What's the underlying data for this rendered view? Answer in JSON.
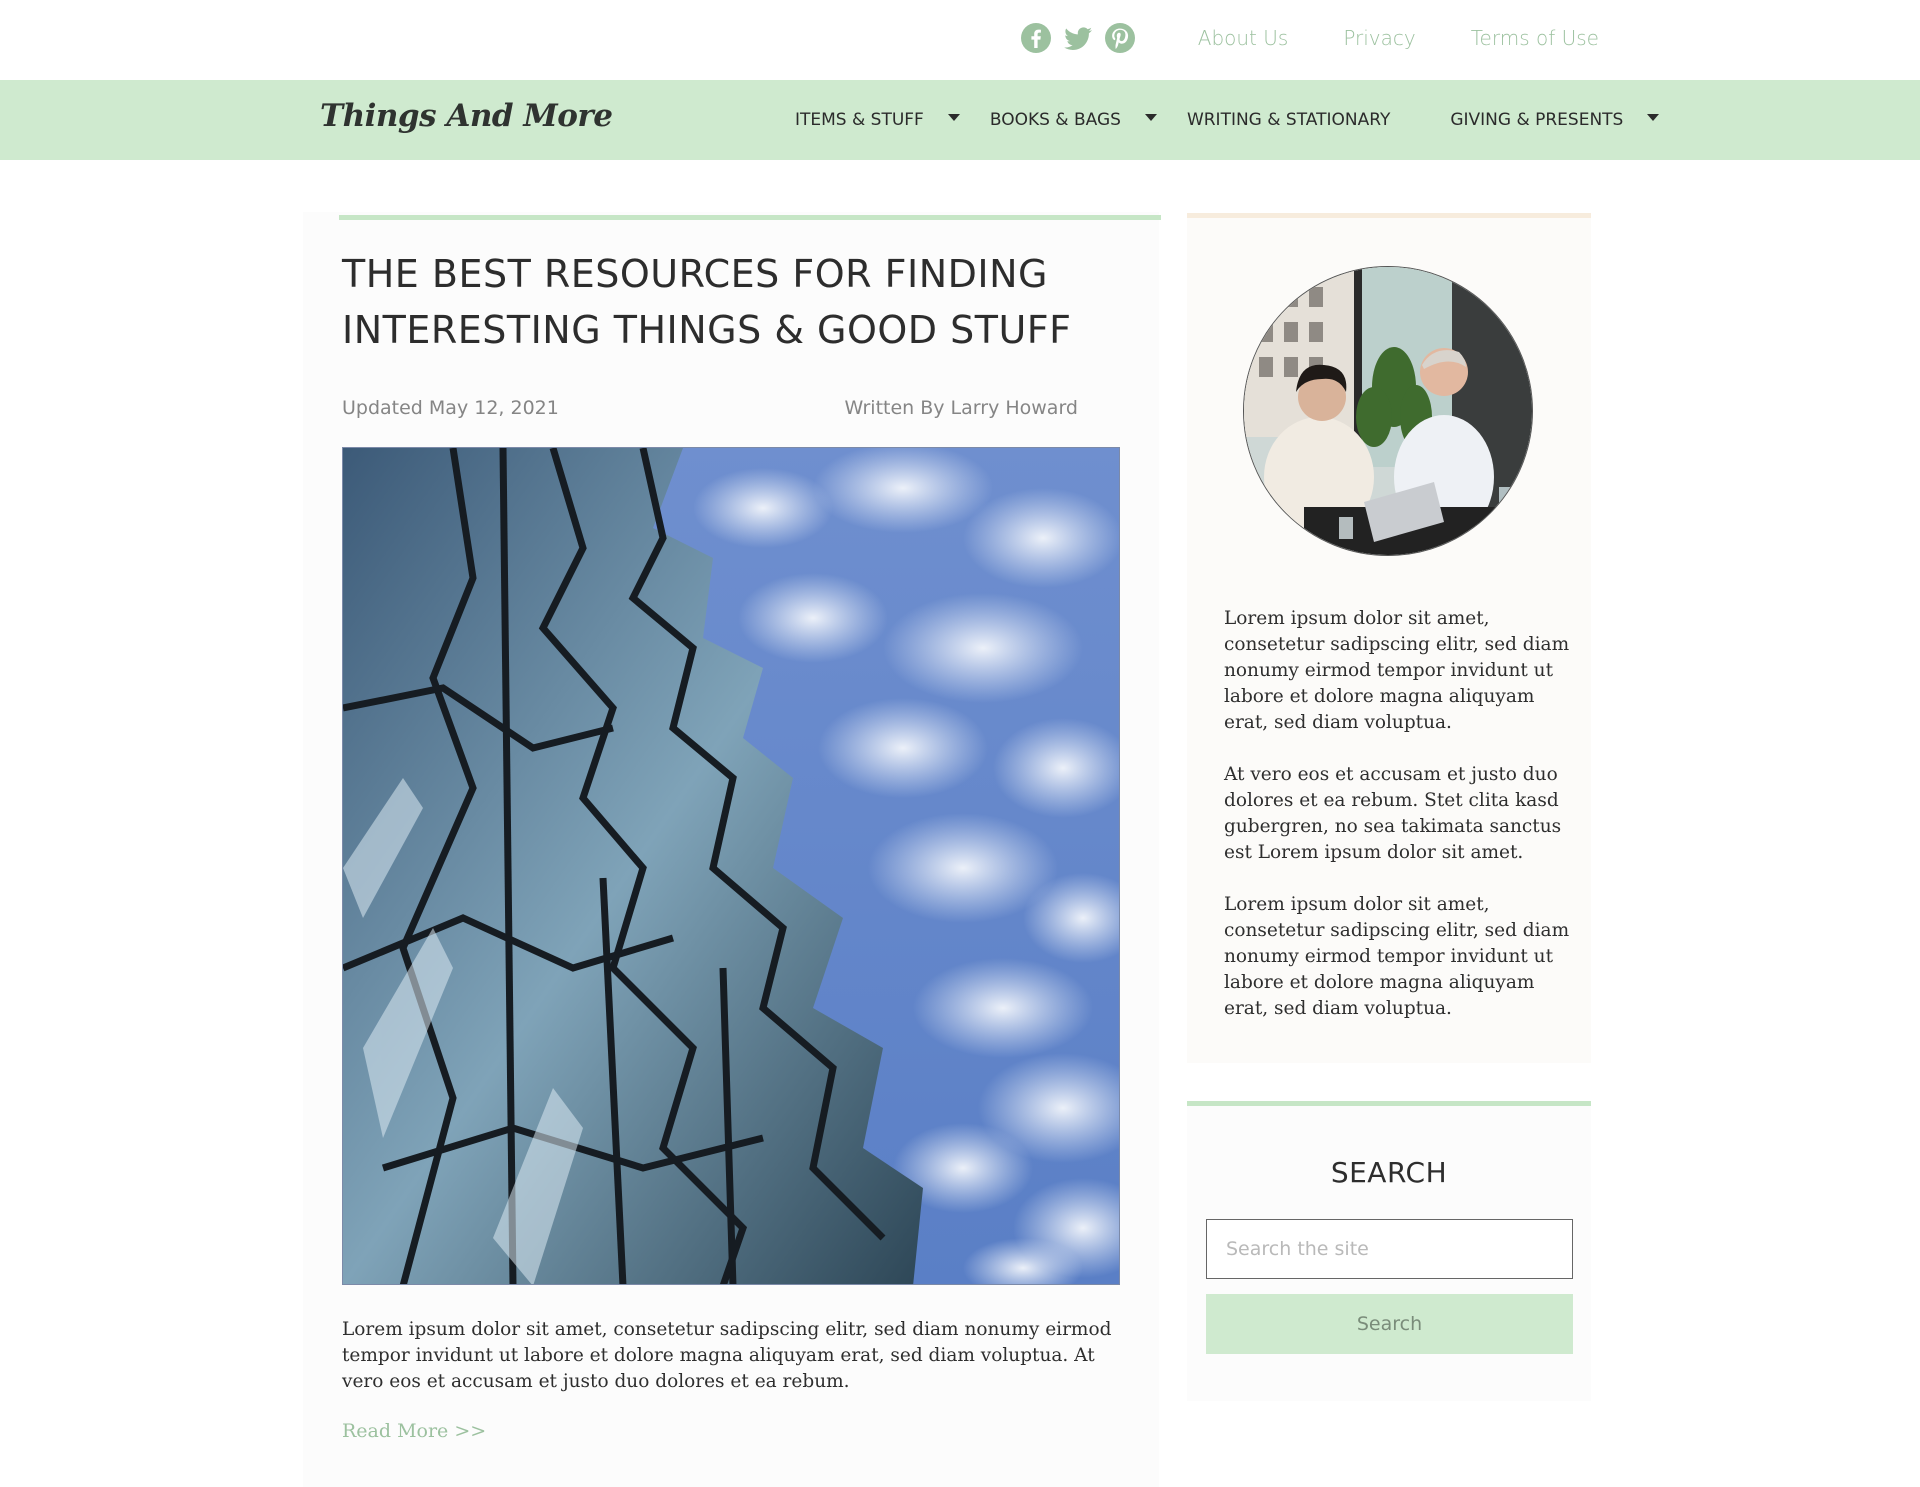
{
  "header": {
    "social": [
      {
        "icon": "facebook-icon"
      },
      {
        "icon": "twitter-icon"
      },
      {
        "icon": "pinterest-icon"
      }
    ],
    "links": [
      "About Us",
      "Privacy",
      "Terms of Use"
    ]
  },
  "nav": {
    "logo": "Things And More",
    "items": [
      {
        "label": "ITEMS & STUFF",
        "has_dropdown": true
      },
      {
        "label": "BOOKS & BAGS",
        "has_dropdown": true
      },
      {
        "label": "WRITING & STATIONARY",
        "has_dropdown": false
      },
      {
        "label": "GIVING & PRESENTS",
        "has_dropdown": true
      }
    ]
  },
  "article": {
    "title_line1": "THE BEST RESOURCES FOR FINDING",
    "title_line2": "INTERESTING THINGS & GOOD STUFF",
    "updated": "Updated May 12, 2021",
    "author": "Written By Larry Howard",
    "excerpt": "Lorem ipsum dolor sit amet, consetetur sadipscing elitr, sed diam nonumy eirmod tempor invidunt ut labore et dolore magna aliquyam erat, sed diam voluptua. At vero eos et accusam et justo duo dolores et ea rebum.",
    "read_more": "Read More >>"
  },
  "sidebar": {
    "about_paragraphs": [
      "Lorem ipsum dolor sit amet, consetetur sadipscing elitr, sed diam nonumy eirmod tempor invidunt ut labore et dolore magna aliquyam erat, sed diam voluptua.",
      "At vero eos et accusam et justo duo dolores et ea rebum. Stet clita kasd gubergren, no sea takimata sanctus est Lorem ipsum dolor sit amet.",
      "Lorem ipsum dolor sit amet, consetetur sadipscing elitr, sed diam nonumy eirmod tempor invidunt ut labore et dolore magna aliquyam erat, sed diam voluptua."
    ],
    "search": {
      "title": "SEARCH",
      "placeholder": "Search the site",
      "value": "",
      "button_label": "Search"
    }
  },
  "colors": {
    "accent_green": "#cfeacf",
    "link_green": "#9cc19f",
    "cream_bar": "#f7ecdd"
  }
}
